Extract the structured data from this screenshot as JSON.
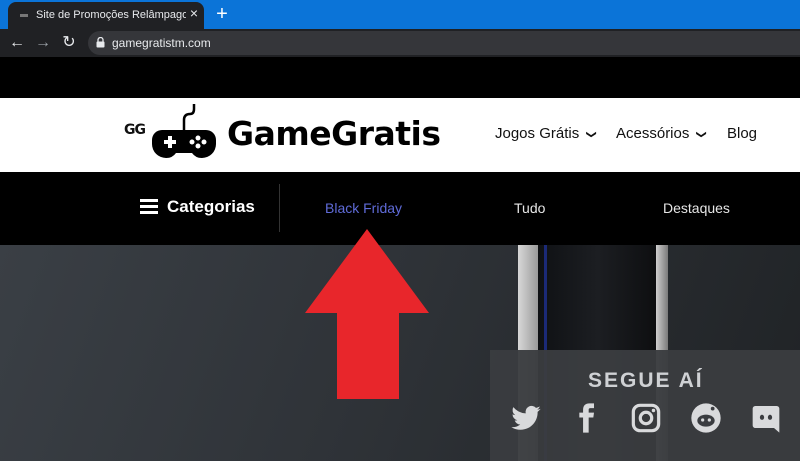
{
  "browser": {
    "tab_title": "Site de Promoções Relâmpago e",
    "tab_close": "×",
    "new_tab": "+",
    "url": "gamegratistm.com",
    "nav": {
      "back": "←",
      "forward": "→",
      "reload": "↻"
    }
  },
  "site": {
    "logo_badge": "GG",
    "brand": "GameGratis",
    "menu": [
      {
        "label": "Jogos Grátis",
        "has_dropdown": true
      },
      {
        "label": "Acessórios",
        "has_dropdown": true
      },
      {
        "label": "Blog",
        "has_dropdown": false
      }
    ],
    "dropdown_chevron": "❯"
  },
  "categories": {
    "label": "Categorias",
    "links": [
      {
        "label": "Black Friday",
        "active": true,
        "color": "#5f6bd8"
      },
      {
        "label": "Tudo",
        "active": false
      },
      {
        "label": "Destaques",
        "active": false
      }
    ]
  },
  "social": {
    "title": "SEGUE AÍ",
    "icons": [
      "twitter-icon",
      "facebook-icon",
      "instagram-icon",
      "reddit-icon",
      "discord-icon"
    ]
  },
  "colors": {
    "tabbar": "#0b74d8",
    "annotation_arrow": "#e8262b"
  }
}
